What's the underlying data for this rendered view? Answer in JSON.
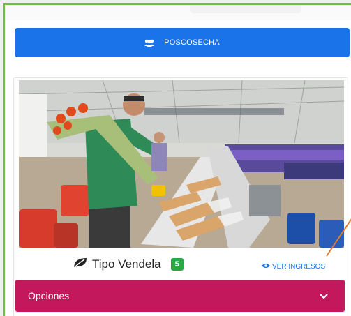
{
  "banner": {
    "label": "POSCOSECHA",
    "icon": "users-icon",
    "color": "#1a73e8"
  },
  "product": {
    "title": "Tipo Vendela",
    "count": "5",
    "leaf_icon": "leaf-icon",
    "link_label": "VER INGRESOS",
    "link_icon": "eye-icon"
  },
  "options": {
    "label": "Opciones",
    "icon": "chevron-down-icon",
    "color": "#c3185b"
  },
  "colors": {
    "frame": "#6dbf43",
    "badge": "#28a745",
    "link": "#1a73e8"
  }
}
